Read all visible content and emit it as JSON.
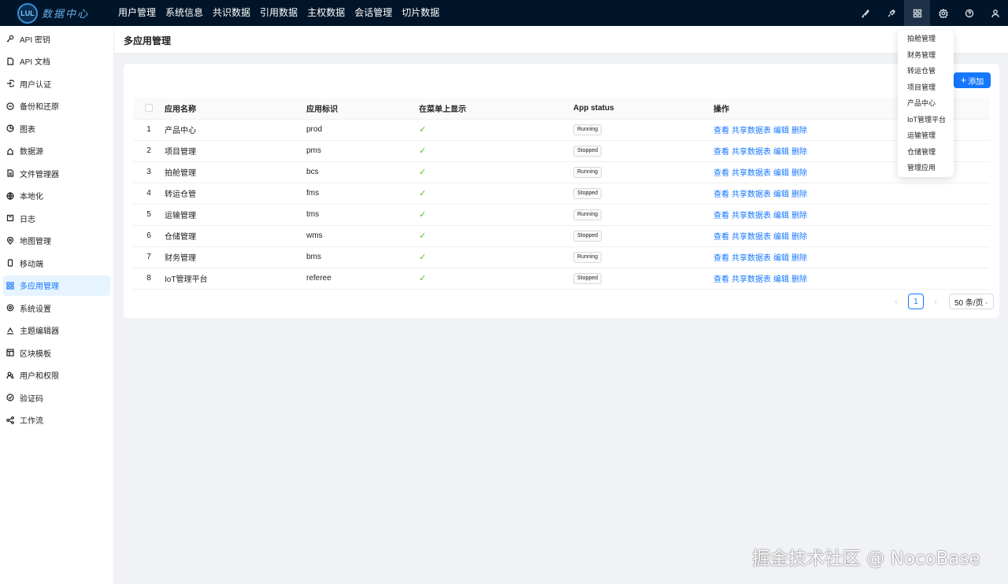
{
  "brand": {
    "logo_text": "数据中心",
    "logo_mark": "LUL"
  },
  "topnav": [
    "用户管理",
    "系统信息",
    "共识数据",
    "引用数据",
    "主权数据",
    "会话管理",
    "切片数据"
  ],
  "top_actions": [
    {
      "name": "brush-icon"
    },
    {
      "name": "plugin-icon"
    },
    {
      "name": "apps-grid-icon"
    },
    {
      "name": "gear-icon"
    },
    {
      "name": "help-icon"
    },
    {
      "name": "user-icon"
    }
  ],
  "sidebar": {
    "items": [
      {
        "label": "API 密钥",
        "icon": "key-icon"
      },
      {
        "label": "API 文档",
        "icon": "file-icon"
      },
      {
        "label": "用户认证",
        "icon": "login-icon"
      },
      {
        "label": "备份和还原",
        "icon": "backup-icon"
      },
      {
        "label": "图表",
        "icon": "pie-chart-icon"
      },
      {
        "label": "数据源",
        "icon": "database-icon"
      },
      {
        "label": "文件管理器",
        "icon": "folder-icon"
      },
      {
        "label": "本地化",
        "icon": "globe-icon"
      },
      {
        "label": "日志",
        "icon": "log-icon"
      },
      {
        "label": "地图管理",
        "icon": "map-pin-icon"
      },
      {
        "label": "移动端",
        "icon": "mobile-icon"
      },
      {
        "label": "多应用管理",
        "icon": "apps-icon",
        "active": true
      },
      {
        "label": "系统设置",
        "icon": "settings-icon"
      },
      {
        "label": "主题编辑器",
        "icon": "theme-icon"
      },
      {
        "label": "区块模板",
        "icon": "layout-icon"
      },
      {
        "label": "用户和权限",
        "icon": "users-icon"
      },
      {
        "label": "验证码",
        "icon": "verify-icon"
      },
      {
        "label": "工作流",
        "icon": "workflow-icon"
      }
    ]
  },
  "page": {
    "title": "多应用管理"
  },
  "toolbar": {
    "add_label": "添加"
  },
  "table": {
    "headers": {
      "title": "应用名称",
      "name": "应用标识",
      "menu": "在菜单上显示",
      "status": "App status",
      "actions": "操作"
    },
    "rows": [
      {
        "index": "1",
        "title": "产品中心",
        "name": "prod",
        "status": "Running"
      },
      {
        "index": "2",
        "title": "项目管理",
        "name": "pms",
        "status": "Stopped"
      },
      {
        "index": "3",
        "title": "拍舱管理",
        "name": "bcs",
        "status": "Running"
      },
      {
        "index": "4",
        "title": "转运仓管",
        "name": "fms",
        "status": "Stopped"
      },
      {
        "index": "5",
        "title": "运输管理",
        "name": "tms",
        "status": "Running"
      },
      {
        "index": "6",
        "title": "仓储管理",
        "name": "wms",
        "status": "Stopped"
      },
      {
        "index": "7",
        "title": "财务管理",
        "name": "bms",
        "status": "Running"
      },
      {
        "index": "8",
        "title": "IoT管理平台",
        "name": "referee",
        "status": "Stopped"
      }
    ],
    "row_actions": [
      "查看",
      "共享数据表",
      "编辑",
      "删除"
    ],
    "check_mark": "✓"
  },
  "pagination": {
    "current": "1",
    "page_size": "50 条/页",
    "prev": "‹",
    "next": "›"
  },
  "app_menu": [
    "拍舱管理",
    "财务管理",
    "转运仓管",
    "项目管理",
    "产品中心",
    "IoT管理平台",
    "运输管理",
    "仓储管理",
    "管理应用"
  ],
  "watermark": "掘金技术社区 @ NocoBase",
  "colors": {
    "primary": "#1677ff",
    "header_bg": "#001529",
    "success": "#52c41a"
  }
}
